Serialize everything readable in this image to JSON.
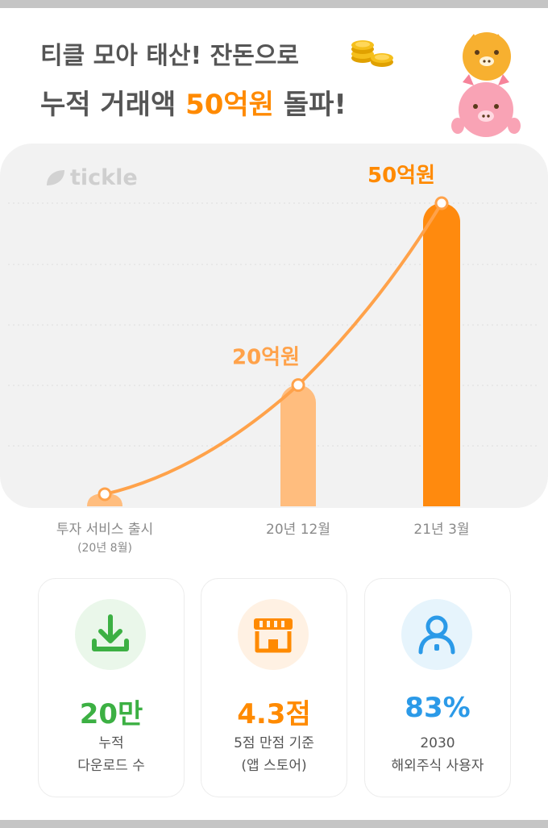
{
  "header": {
    "line1": "티클 모아 태산! 잔돈으로",
    "line2_prefix": "누적 거래액 ",
    "line2_highlight": "50억원",
    "line2_suffix": " 돌파!"
  },
  "brand": {
    "logo_text": "tickle"
  },
  "chart_data": {
    "type": "bar",
    "categories": [
      "투자 서비스 출시",
      "20년 12월",
      "21년 3월"
    ],
    "category_sublabels": [
      "(20년 8월)",
      "",
      ""
    ],
    "values": [
      0,
      20,
      50
    ],
    "value_unit": "억원",
    "data_labels": [
      "",
      "20억원",
      "50억원"
    ],
    "ylim": [
      0,
      50
    ],
    "grid": true,
    "trend_line": true,
    "colors": {
      "bar_mid": "#ffbd7e",
      "bar_high": "#ff8a0e",
      "line": "#ffa24a",
      "label_mid": "#ffa24a",
      "label_high": "#ff8a00"
    }
  },
  "stats": [
    {
      "value": "20만",
      "desc1": "누적",
      "desc2": "다운로드 수",
      "icon": "download-icon",
      "color": "#3cb043",
      "bg": "#eaf7ea"
    },
    {
      "value": "4.3점",
      "desc1": "5점 만점 기준",
      "desc2": "(앱 스토어)",
      "icon": "store-icon",
      "color": "#ff8a00",
      "bg": "#fff1e3"
    },
    {
      "value": "83%",
      "desc1": "2030",
      "desc2": "해외주식 사용자",
      "icon": "user-icon",
      "color": "#2b9ae8",
      "bg": "#e6f4fc"
    }
  ],
  "colors": {
    "accent": "#ff8a00",
    "heading": "#555555",
    "panel": "#f2f2f2"
  }
}
